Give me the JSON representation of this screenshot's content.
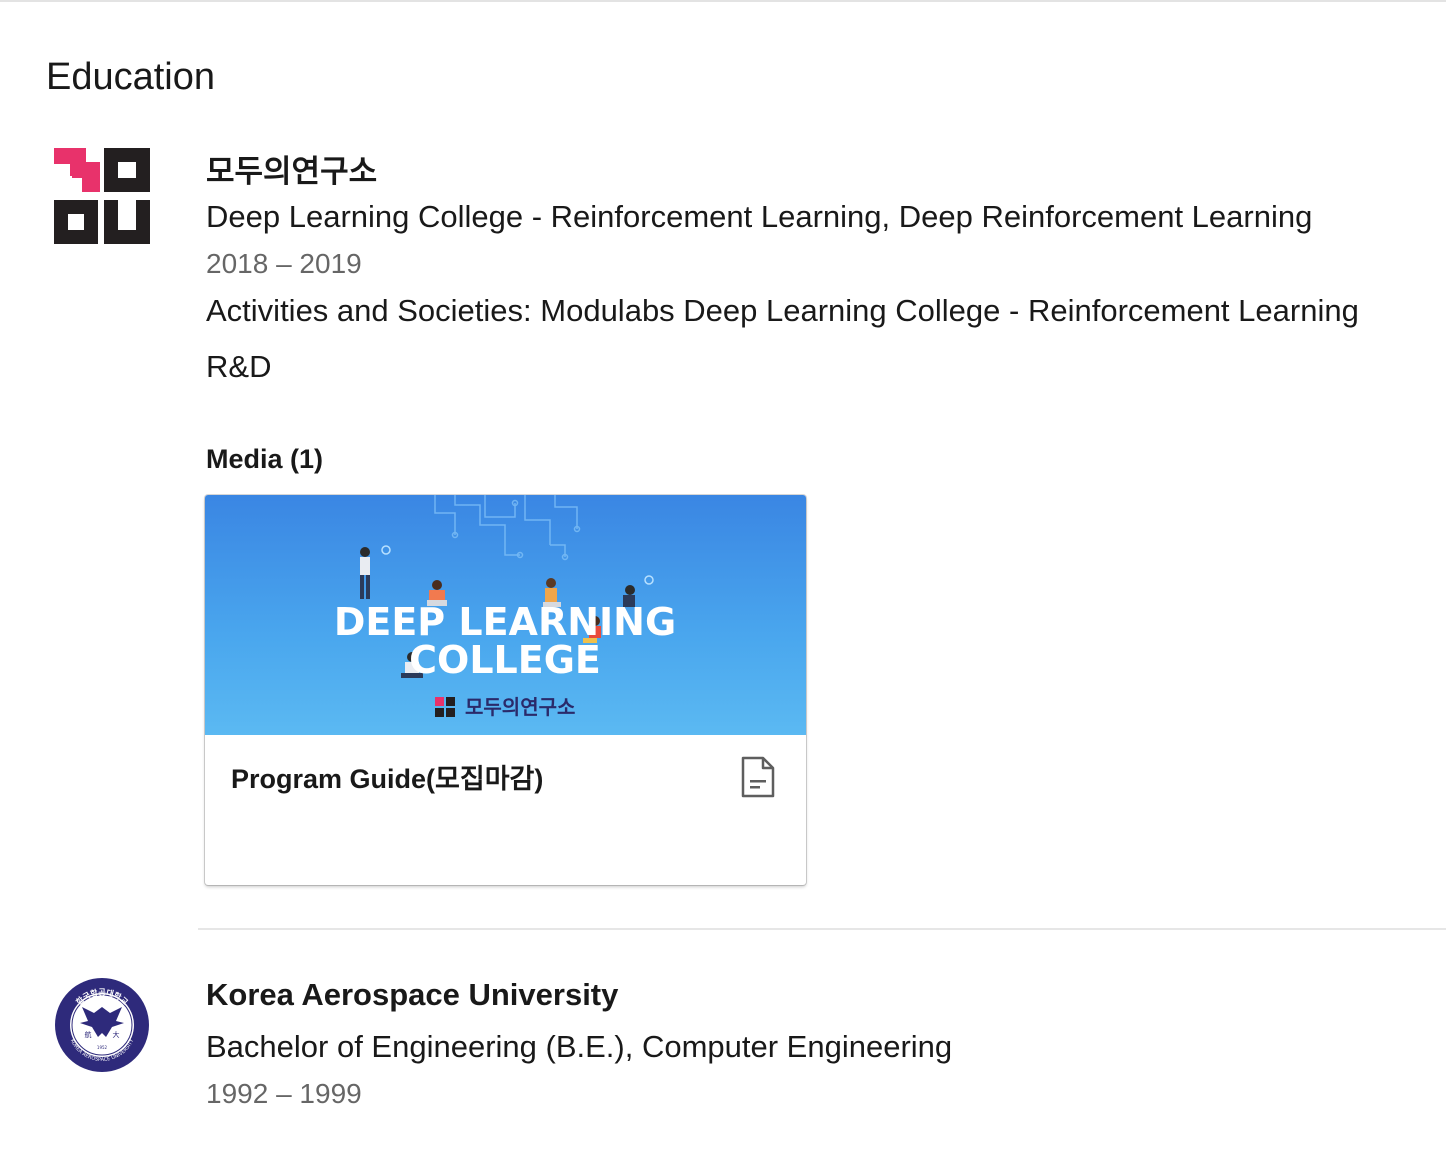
{
  "section": {
    "title": "Education"
  },
  "entries": [
    {
      "school": "모두의연구소",
      "degree": "Deep Learning College - Reinforcement Learning, Deep Reinforcement Learning",
      "dates": "2018 – 2019",
      "activities": "Activities and Societies: Modulabs Deep Learning College - Reinforcement Learning",
      "description": "R&D",
      "logo": "modulabs-logo",
      "media": {
        "heading": "Media (1)",
        "items": [
          {
            "title": "Program Guide(모집마감)",
            "thumbnail_text": {
              "line1": "DEEP LEARNING",
              "line2": "COLLEGE",
              "brand": "모두의연구소"
            },
            "icon": "document-icon"
          }
        ]
      }
    },
    {
      "school": "Korea Aerospace University",
      "degree": "Bachelor of Engineering (B.E.), Computer Engineering",
      "dates": "1992 – 1999",
      "logo": "kau-seal-logo",
      "seal_text": {
        "top": "한국항공대학교",
        "bottom": "KOREA AEROSPACE UNIVERSITY",
        "year": "1952"
      }
    }
  ],
  "colors": {
    "modu_pink": "#e8326b",
    "modu_dark": "#231f20",
    "kau_navy": "#2e2a7b",
    "thumb_top": "#3a86e3",
    "thumb_bottom": "#5bb9f2"
  }
}
